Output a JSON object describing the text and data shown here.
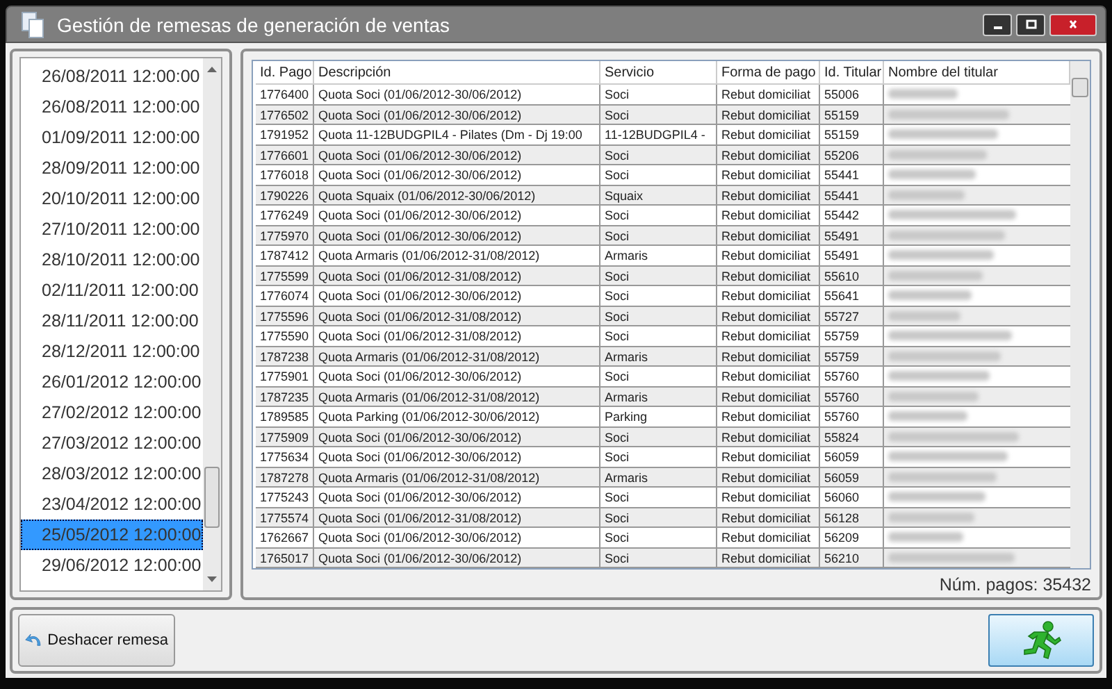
{
  "window": {
    "title": "Gestión de remesas de generación de ventas"
  },
  "dates": [
    {
      "label": "26/08/2011 12:00:00",
      "selected": false
    },
    {
      "label": "26/08/2011 12:00:00",
      "selected": false
    },
    {
      "label": "01/09/2011 12:00:00",
      "selected": false
    },
    {
      "label": "28/09/2011 12:00:00",
      "selected": false
    },
    {
      "label": "20/10/2011 12:00:00",
      "selected": false
    },
    {
      "label": "27/10/2011 12:00:00",
      "selected": false
    },
    {
      "label": "28/10/2011 12:00:00",
      "selected": false
    },
    {
      "label": "02/11/2011 12:00:00",
      "selected": false
    },
    {
      "label": "28/11/2011 12:00:00",
      "selected": false
    },
    {
      "label": "28/12/2011 12:00:00",
      "selected": false
    },
    {
      "label": "26/01/2012 12:00:00",
      "selected": false
    },
    {
      "label": "27/02/2012 12:00:00",
      "selected": false
    },
    {
      "label": "27/03/2012 12:00:00",
      "selected": false
    },
    {
      "label": "28/03/2012 12:00:00",
      "selected": false
    },
    {
      "label": "23/04/2012 12:00:00",
      "selected": false
    },
    {
      "label": "25/05/2012 12:00:00",
      "selected": true
    },
    {
      "label": "29/06/2012 12:00:00",
      "selected": false
    }
  ],
  "table": {
    "columns": [
      "Id. Pago",
      "Descripción",
      "Servicio",
      "Forma de pago",
      "Id. Titular",
      "Nombre del titular"
    ],
    "rows": [
      [
        "1776400",
        "Quota Soci (01/06/2012-30/06/2012)",
        "Soci",
        "Rebut domiciliat",
        "55006"
      ],
      [
        "1776502",
        "Quota Soci (01/06/2012-30/06/2012)",
        "Soci",
        "Rebut domiciliat",
        "55159"
      ],
      [
        "1791952",
        "Quota 11-12BUDGPIL4 - Pilates (Dm - Dj 19:00",
        "11-12BUDGPIL4 -",
        "Rebut domiciliat",
        "55159"
      ],
      [
        "1776601",
        "Quota Soci (01/06/2012-30/06/2012)",
        "Soci",
        "Rebut domiciliat",
        "55206"
      ],
      [
        "1776018",
        "Quota Soci (01/06/2012-30/06/2012)",
        "Soci",
        "Rebut domiciliat",
        "55441"
      ],
      [
        "1790226",
        "Quota Squaix (01/06/2012-30/06/2012)",
        "Squaix",
        "Rebut domiciliat",
        "55441"
      ],
      [
        "1776249",
        "Quota Soci (01/06/2012-30/06/2012)",
        "Soci",
        "Rebut domiciliat",
        "55442"
      ],
      [
        "1775970",
        "Quota Soci (01/06/2012-30/06/2012)",
        "Soci",
        "Rebut domiciliat",
        "55491"
      ],
      [
        "1787412",
        "Quota Armaris (01/06/2012-31/08/2012)",
        "Armaris",
        "Rebut domiciliat",
        "55491"
      ],
      [
        "1775599",
        "Quota Soci (01/06/2012-31/08/2012)",
        "Soci",
        "Rebut domiciliat",
        "55610"
      ],
      [
        "1776074",
        "Quota Soci (01/06/2012-30/06/2012)",
        "Soci",
        "Rebut domiciliat",
        "55641"
      ],
      [
        "1775596",
        "Quota Soci (01/06/2012-31/08/2012)",
        "Soci",
        "Rebut domiciliat",
        "55727"
      ],
      [
        "1775590",
        "Quota Soci (01/06/2012-31/08/2012)",
        "Soci",
        "Rebut domiciliat",
        "55759"
      ],
      [
        "1787238",
        "Quota Armaris (01/06/2012-31/08/2012)",
        "Armaris",
        "Rebut domiciliat",
        "55759"
      ],
      [
        "1775901",
        "Quota Soci (01/06/2012-30/06/2012)",
        "Soci",
        "Rebut domiciliat",
        "55760"
      ],
      [
        "1787235",
        "Quota Armaris (01/06/2012-31/08/2012)",
        "Armaris",
        "Rebut domiciliat",
        "55760"
      ],
      [
        "1789585",
        "Quota Parking (01/06/2012-30/06/2012)",
        "Parking",
        "Rebut domiciliat",
        "55760"
      ],
      [
        "1775909",
        "Quota Soci (01/06/2012-30/06/2012)",
        "Soci",
        "Rebut domiciliat",
        "55824"
      ],
      [
        "1775634",
        "Quota Soci (01/06/2012-30/06/2012)",
        "Soci",
        "Rebut domiciliat",
        "56059"
      ],
      [
        "1787278",
        "Quota Armaris (01/06/2012-31/08/2012)",
        "Armaris",
        "Rebut domiciliat",
        "56059"
      ],
      [
        "1775243",
        "Quota Soci (01/06/2012-30/06/2012)",
        "Soci",
        "Rebut domiciliat",
        "56060"
      ],
      [
        "1775574",
        "Quota Soci (01/06/2012-31/08/2012)",
        "Soci",
        "Rebut domiciliat",
        "56128"
      ],
      [
        "1762667",
        "Quota Soci (01/06/2012-30/06/2012)",
        "Soci",
        "Rebut domiciliat",
        "56209"
      ],
      [
        "1765017",
        "Quota Soci (01/06/2012-30/06/2012)",
        "Soci",
        "Rebut domiciliat",
        "56210"
      ]
    ]
  },
  "count": "Núm. pagos: 35432",
  "undo_button": {
    "label": "Deshacer remesa"
  }
}
